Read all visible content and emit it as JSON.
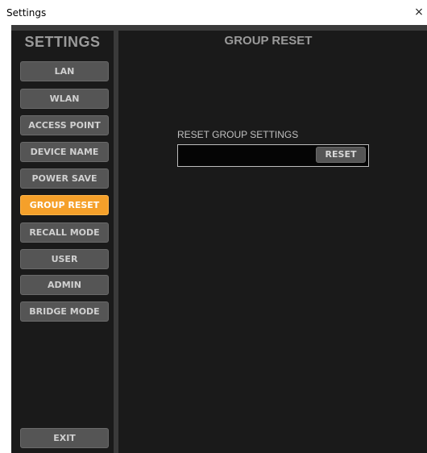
{
  "window": {
    "title": "Settings",
    "close_glyph": "×"
  },
  "sidebar": {
    "heading": "SETTINGS",
    "items": [
      {
        "label": "LAN",
        "active": false
      },
      {
        "label": "WLAN",
        "active": false
      },
      {
        "label": "ACCESS POINT",
        "active": false
      },
      {
        "label": "DEVICE NAME",
        "active": false
      },
      {
        "label": "POWER SAVE",
        "active": false
      },
      {
        "label": "GROUP RESET",
        "active": true
      },
      {
        "label": "RECALL MODE",
        "active": false
      },
      {
        "label": "USER",
        "active": false
      },
      {
        "label": "ADMIN",
        "active": false
      },
      {
        "label": "BRIDGE MODE",
        "active": false
      }
    ],
    "exit_label": "EXIT"
  },
  "main": {
    "title": "GROUP RESET",
    "field_label": "RESET GROUP SETTINGS",
    "reset_button_label": "RESET"
  },
  "colors": {
    "background": "#1a1a1a",
    "frame": "#3a3a3a",
    "button": "#555555",
    "accent": "#f5a02a",
    "text_muted": "#9a9a9a"
  }
}
